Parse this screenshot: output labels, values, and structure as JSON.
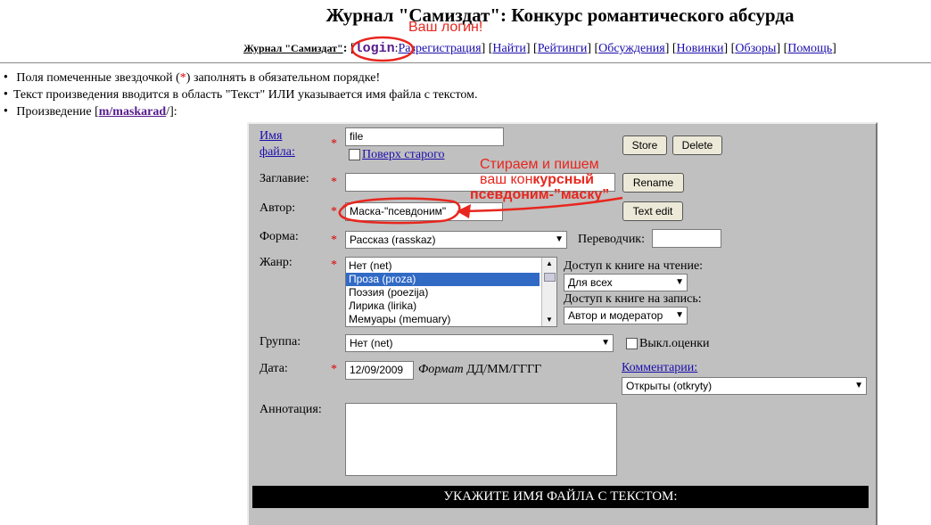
{
  "page": {
    "title": "Журнал \"Самиздат\": Конкурс романтического абсурда"
  },
  "nav": {
    "home": "Журнал \"Самиздат\"",
    "login": "login",
    "links": [
      "Разрегистрация",
      "Найти",
      "Рейтинги",
      "Обсуждения",
      "Новинки",
      "Обзоры",
      "Помощь"
    ]
  },
  "notes": {
    "required_pre": "Поля помеченные звездочкой (",
    "star": "*",
    "required_post": ") заполнять в обязательном порядке!",
    "text_hint": "Текст произведения вводится в область \"Текст\" ИЛИ указывается имя файла с текстом.",
    "work_label": "Произведение [",
    "work_link": "m/maskarad",
    "work_suffix": "/]:"
  },
  "form": {
    "filename_label_1": "Имя",
    "filename_label_2": "файла:",
    "filename_value": "file",
    "overwrite_label": "Поверх старого",
    "store": "Store",
    "delete": "Delete",
    "title_label": "Заглавие:",
    "title_value": "",
    "rename": "Rename",
    "author_label": "Автор:",
    "author_value": "Маска-\"псевдоним\"",
    "text_edit": "Text edit",
    "form_label": "Форма:",
    "form_value": "Рассказ (rasskaz)",
    "translator_label": "Переводчик:",
    "translator_value": "",
    "genre_label": "Жанр:",
    "genres": [
      "Нет (net)",
      "Проза (proza)",
      "Поэзия (poezija)",
      "Лирика (lirika)",
      "Мемуары (memuary)"
    ],
    "genre_selected": "Проза (proza)",
    "read_access_label": "Доступ к книге на чтение:",
    "read_access_value": "Для всех",
    "write_access_label": "Доступ к книге на запись:",
    "write_access_value": "Автор и модератор",
    "group_label": "Группа:",
    "group_value": "Нет (net)",
    "ratings_off_label": "Выкл.оценки",
    "date_label": "Дата:",
    "date_value": "12/09/2009",
    "date_format_italic": "Формат",
    "date_format": "ДД/ММ/ГГГГ",
    "comments_label": "Комментарии:",
    "comments_value": "Открыты (otkryty)",
    "annotation_label": "Аннотация:",
    "banner": "УКАЖИТЕ ИМЯ ФАЙЛА С ТЕКСТОМ:"
  },
  "annotations": {
    "login_hint": "Ваш логин!",
    "erase_line1": "Стираем и пишем",
    "erase_line2_pre": "ваш кон",
    "erase_line2_bold": "курсный",
    "erase_line3": "псевдоним-”маску”"
  },
  "colors": {
    "annotation": "#e8261e",
    "form_bg": "#c0c0c0",
    "selected": "#316ac5"
  }
}
